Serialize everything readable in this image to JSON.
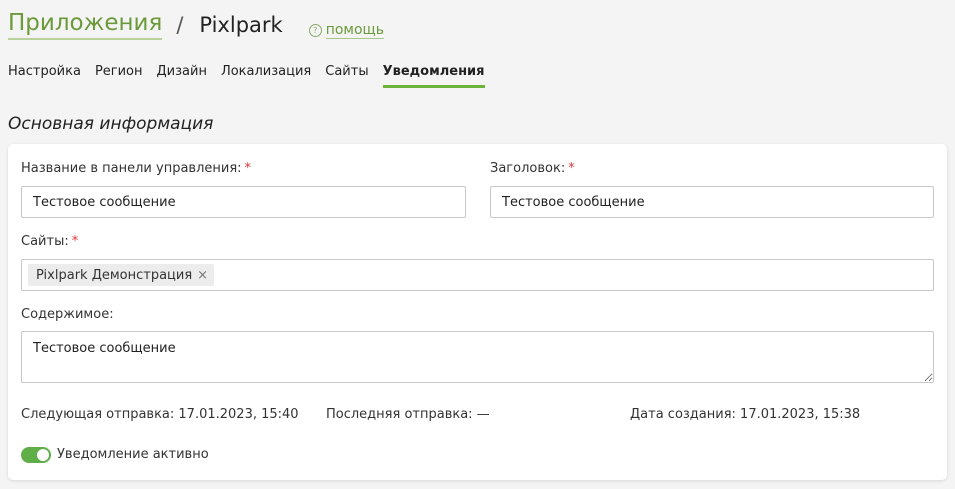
{
  "header": {
    "root_label": "Приложения",
    "separator": "/",
    "current": "Pixlpark",
    "help_icon_glyph": "?",
    "help_label": "помощь"
  },
  "tabs": [
    {
      "label": "Настройка",
      "active": false
    },
    {
      "label": "Регион",
      "active": false
    },
    {
      "label": "Дизайн",
      "active": false
    },
    {
      "label": "Локализация",
      "active": false
    },
    {
      "label": "Сайты",
      "active": false
    },
    {
      "label": "Уведомления",
      "active": true
    }
  ],
  "section_title": "Основная информация",
  "form": {
    "admin_name_label": "Название в панели управления:",
    "admin_name_value": "Тестовое сообщение",
    "heading_label": "Заголовок:",
    "heading_value": "Тестовое сообщение",
    "sites_label": "Сайты:",
    "sites_tags": [
      "Pixlpark Демонстрация"
    ],
    "tag_remove_glyph": "×",
    "content_label": "Содержимое:",
    "content_value": "Тестовое сообщение",
    "required_mark": "*"
  },
  "meta": {
    "next_send": "Следующая отправка: 17.01.2023, 15:40",
    "last_send": "Последняя отправка: —",
    "created": "Дата создания: 17.01.2023, 15:38"
  },
  "toggle": {
    "label": "Уведомление активно",
    "on": true
  },
  "colors": {
    "accent": "#6bb33a",
    "link": "#6a9a3a",
    "required": "#d33333",
    "toggle_on": "#5fae47"
  }
}
